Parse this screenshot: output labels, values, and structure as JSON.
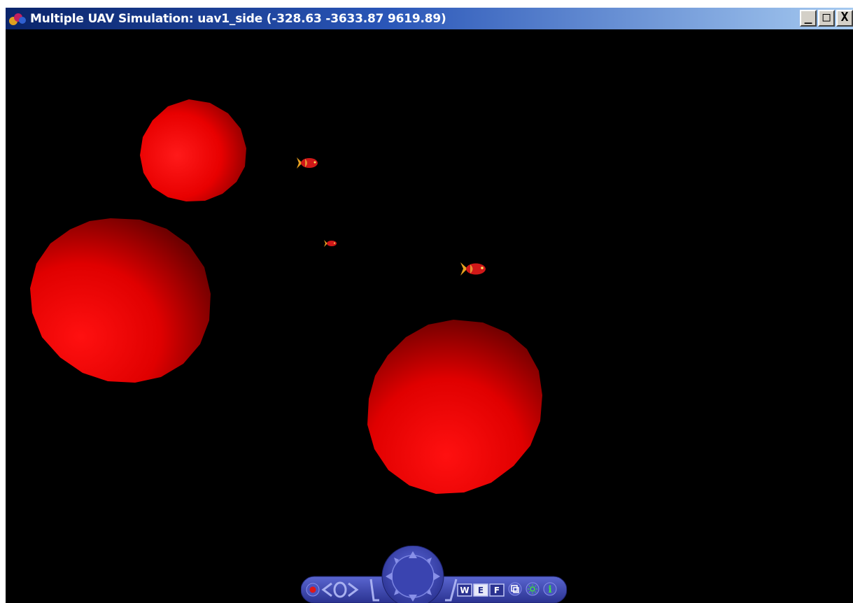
{
  "window": {
    "title": "Multiple UAV Simulation: uav1_side (-328.63 -3633.87 9619.89)",
    "buttons": {
      "minimize": "_",
      "maximize": "□",
      "close": "X"
    }
  },
  "scene": {
    "background": "#000000",
    "sphere_color": "#ff0000",
    "objects": [
      {
        "type": "sphere",
        "name": "sphere-top-left"
      },
      {
        "type": "sphere",
        "name": "sphere-left"
      },
      {
        "type": "sphere",
        "name": "sphere-bottom-center"
      },
      {
        "type": "fish",
        "name": "fish-1"
      },
      {
        "type": "fish",
        "name": "fish-2"
      },
      {
        "type": "fish",
        "name": "fish-3"
      }
    ]
  },
  "navigator": {
    "accent": "#3a44b0",
    "buttons": {
      "walk": "W",
      "examine": "E",
      "fly": "F",
      "info": "i"
    }
  }
}
